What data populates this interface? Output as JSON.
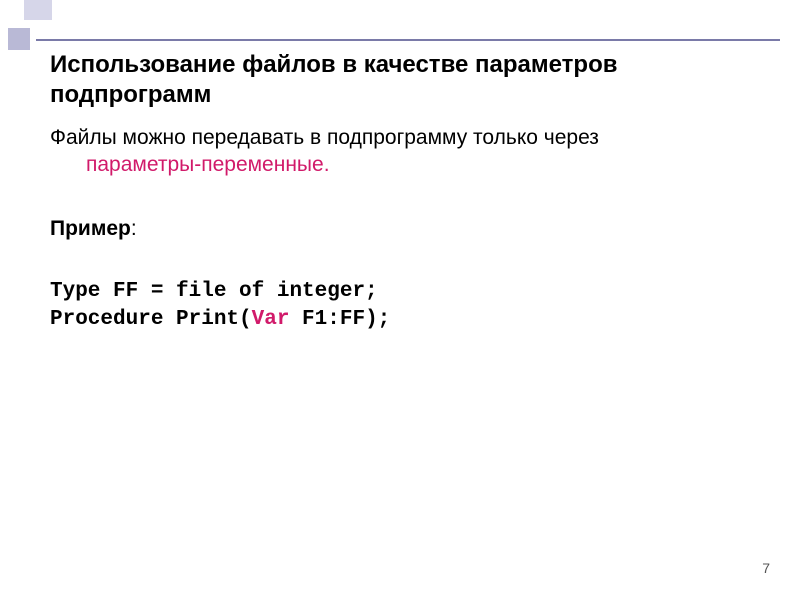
{
  "title": "Использование файлов в качестве параметров подпрограмм",
  "body": {
    "line1_prefix": "Файлы можно передавать в подпрограмму только через ",
    "line1_highlight": "параметры-переменные."
  },
  "example_label": "Пример",
  "example_colon": ":",
  "code": {
    "line1": "Type FF = file of integer;",
    "line2_part1": "Procedure Print(",
    "line2_kw": "Var",
    "line2_part2": " F1:FF);"
  },
  "page_number": "7"
}
